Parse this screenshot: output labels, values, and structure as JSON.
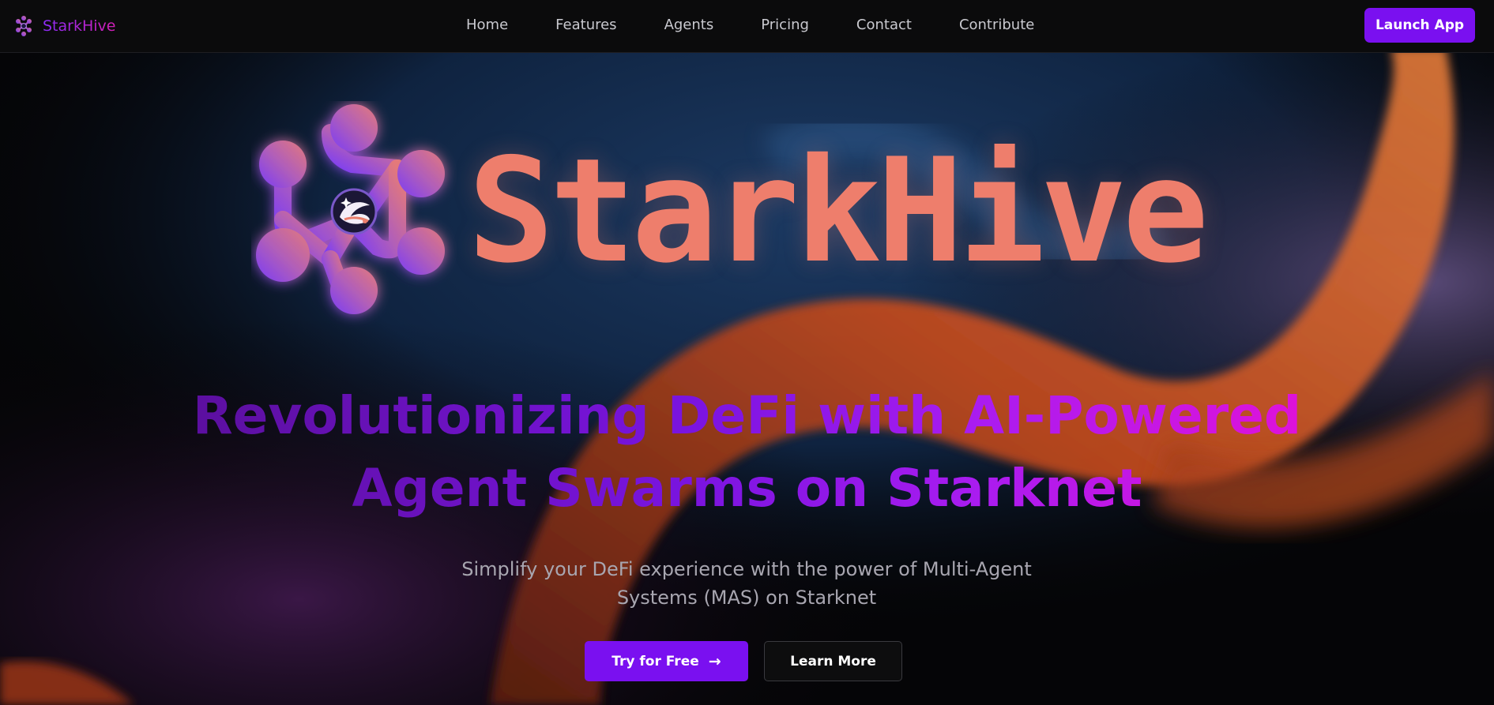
{
  "nav": {
    "brand": "StarkHive",
    "logo_icon": "network-hive-icon",
    "links": [
      "Home",
      "Features",
      "Agents",
      "Pricing",
      "Contact",
      "Contribute"
    ],
    "launch_label": "Launch App"
  },
  "hero": {
    "emblem_icon": "starknet-network-emblem-icon",
    "brand_title": "StarkHive",
    "headline": "Revolutionizing DeFi with AI-Powered Agent Swarms on Starknet",
    "subtitle": "Simplify your DeFi experience with the power of Multi-Agent Systems (MAS) on Starknet",
    "primary_cta": "Try for Free",
    "primary_cta_icon": "arrow-right-icon",
    "secondary_cta": "Learn More"
  },
  "colors": {
    "accent_purple": "#7a10f0",
    "brand_coral": "#ee7e6c",
    "headline_gradient_start": "#5b0f9e",
    "headline_gradient_end": "#e012d9",
    "background": "#050507"
  }
}
